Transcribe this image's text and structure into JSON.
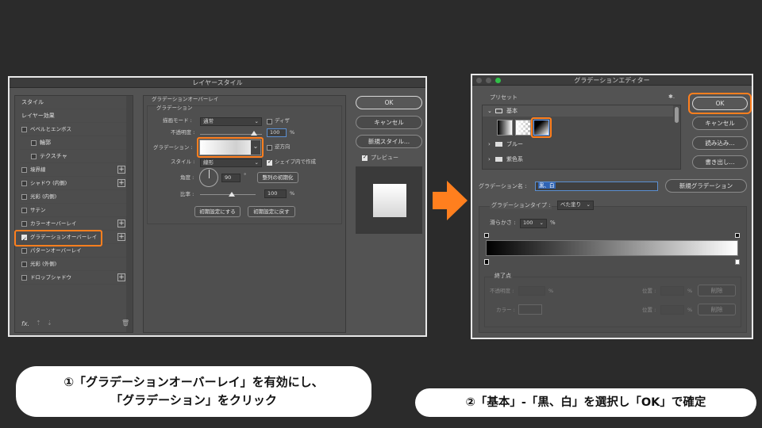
{
  "layer_style": {
    "title": "レイヤースタイル",
    "sidebar": {
      "items": [
        {
          "label": "スタイル",
          "check": false,
          "plus": false,
          "indent": false,
          "on": false
        },
        {
          "label": "レイヤー効果",
          "check": false,
          "plus": false,
          "indent": false,
          "on": false
        },
        {
          "label": "ベベルとエンボス",
          "check": true,
          "plus": false,
          "indent": false,
          "on": false
        },
        {
          "label": "輪郭",
          "check": true,
          "plus": false,
          "indent": true,
          "on": false
        },
        {
          "label": "テクスチャ",
          "check": true,
          "plus": false,
          "indent": true,
          "on": false
        },
        {
          "label": "境界線",
          "check": true,
          "plus": true,
          "indent": false,
          "on": false
        },
        {
          "label": "シャドウ (内側)",
          "check": true,
          "plus": true,
          "indent": false,
          "on": false
        },
        {
          "label": "光彩 (内側)",
          "check": true,
          "plus": false,
          "indent": false,
          "on": false
        },
        {
          "label": "サテン",
          "check": true,
          "plus": false,
          "indent": false,
          "on": false
        },
        {
          "label": "カラーオーバーレイ",
          "check": true,
          "plus": true,
          "indent": false,
          "on": false
        },
        {
          "label": "グラデーションオーバーレイ",
          "check": true,
          "plus": true,
          "indent": false,
          "on": true
        },
        {
          "label": "パターンオーバーレイ",
          "check": true,
          "plus": false,
          "indent": false,
          "on": false
        },
        {
          "label": "光彩 (外側)",
          "check": true,
          "plus": false,
          "indent": false,
          "on": false
        },
        {
          "label": "ドロップシャドウ",
          "check": true,
          "plus": true,
          "indent": false,
          "on": false
        }
      ],
      "fx_label": "fx."
    },
    "panel": {
      "section_title": "グラデーションオーバーレイ",
      "subsection_title": "グラデーション",
      "blend_mode_label": "描画モード :",
      "blend_mode_value": "通常",
      "dither_label": "ディザ",
      "opacity_label": "不透明度 :",
      "opacity_value": "100",
      "opacity_unit": "%",
      "gradient_label": "グラデーション :",
      "reverse_label": "逆方向",
      "style_label": "スタイル :",
      "style_value": "線形",
      "align_label": "シェイプ内で作成",
      "angle_label": "角度 :",
      "angle_value": "90",
      "angle_unit": "°",
      "reset_align_label": "整列の初期化",
      "scale_label": "比率 :",
      "scale_value": "100",
      "scale_unit": "%",
      "make_default_label": "初期設定にする",
      "reset_default_label": "初期設定に戻す"
    },
    "buttons": {
      "ok": "OK",
      "cancel": "キャンセル",
      "new_style": "新規スタイル...",
      "preview": "プレビュー"
    }
  },
  "gradient_editor": {
    "title": "グラデーションエディター",
    "presets_label": "プリセット",
    "gear_label": "✱.",
    "groups": [
      {
        "label": "基本",
        "expanded": true
      },
      {
        "label": "ブルー",
        "expanded": false
      },
      {
        "label": "紫色系",
        "expanded": false
      }
    ],
    "buttons": {
      "ok": "OK",
      "cancel": "キャンセル",
      "load": "読み込み...",
      "save": "書き出し...",
      "new_gradient": "新規グラデーション"
    },
    "name_label": "グラデーション名 :",
    "name_value": "黒、白",
    "type_label": "グラデーションタイプ :",
    "type_value": "べた塗り",
    "smooth_label": "滑らかさ :",
    "smooth_value": "100",
    "smooth_unit": "%",
    "stops_title": "終了点",
    "opacity_label": "不透明度 :",
    "opacity_unit": "%",
    "position_label": "位置 :",
    "position_unit": "%",
    "delete_label": "削除",
    "color_label": "カラー :"
  },
  "captions": {
    "step1_line1": "①「グラデーションオーバーレイ」を有効にし、",
    "step1_line2": "「グラデーション」をクリック",
    "step2": "②「基本」-「黒、白」を選択し「OK」で確定"
  },
  "colors": {
    "highlight": "#ff7f1e",
    "arrow": "#ff7f1e"
  }
}
